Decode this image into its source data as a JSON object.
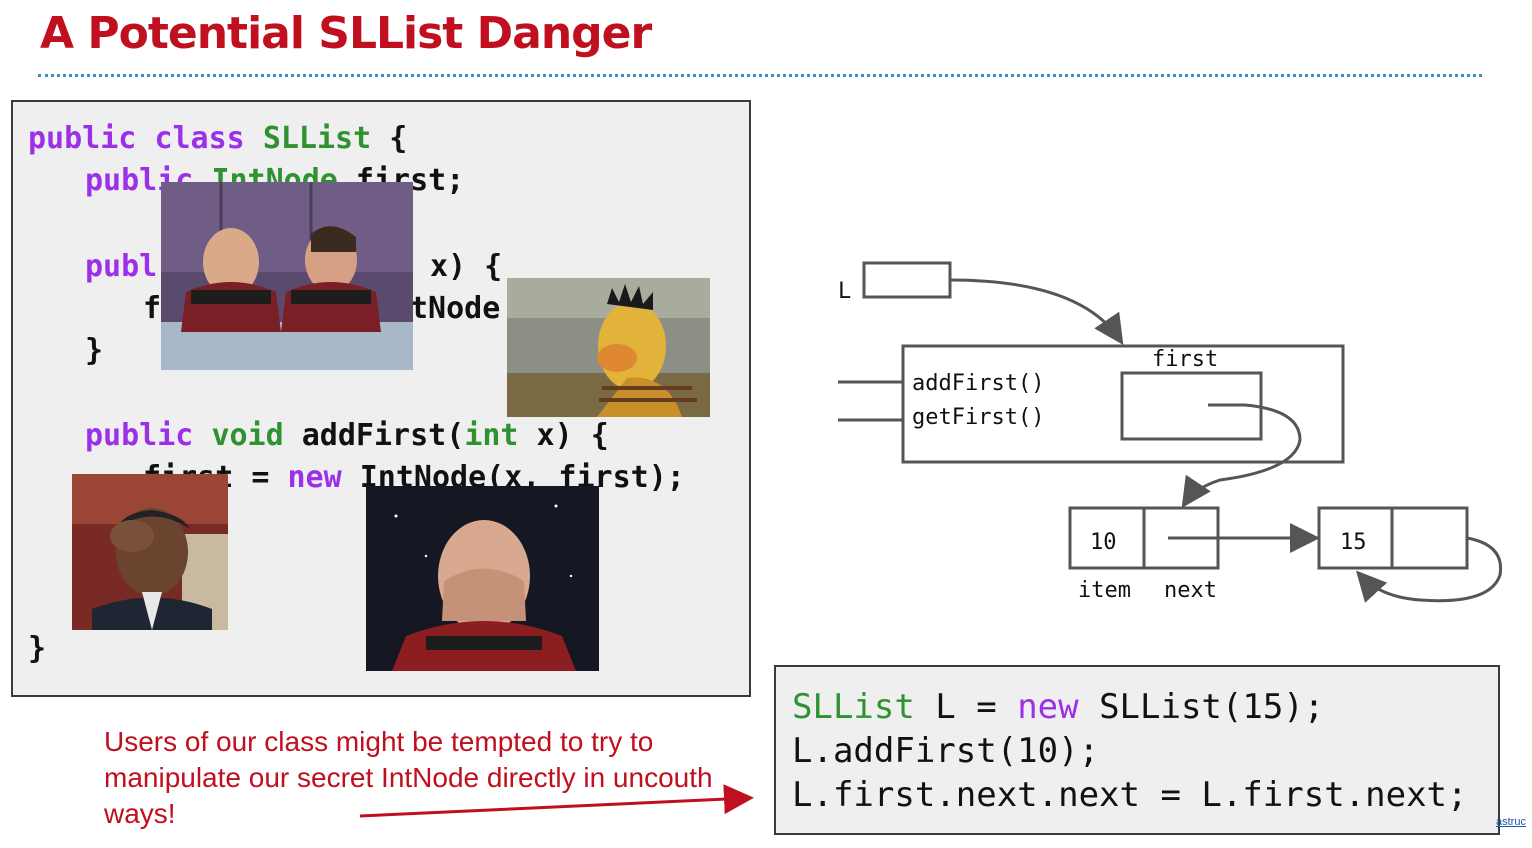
{
  "title": "A Potential SLList Danger",
  "code": {
    "line1": {
      "kw1": "public",
      "kw2": "class",
      "name": "SLList",
      "brace": " {"
    },
    "line2": {
      "kw": "public",
      "type": "IntNode",
      "rest": " first;"
    },
    "line3": {
      "kw": "publ",
      "rest": "x) {"
    },
    "line4": {
      "start": "f",
      "rest": "tNode"
    },
    "line5": "}",
    "line6": {
      "kw1": "public",
      "kw2": "void",
      "name": " addFirst(",
      "type": "int",
      "rest": " x) {"
    },
    "line7": {
      "start": "first = ",
      "kw": "new",
      "rest": " IntNode(x, first);"
    },
    "line8": "}"
  },
  "note": "Users of our class might be tempted to try to manipulate our secret IntNode directly in uncouth ways!",
  "client_code": {
    "line1": {
      "type": "SLList",
      "mid": " L = ",
      "kw": "new",
      "rest": " SLList(15);"
    },
    "line2": "L.addFirst(10);",
    "line3": "L.first.next.next = L.first.next;"
  },
  "diagram": {
    "var_label": "L",
    "field_label": "first",
    "method1": "addFirst()",
    "method2": "getFirst()",
    "node1_item": "10",
    "node2_item": "15",
    "item_label": "item",
    "next_label": "next"
  },
  "images": [
    "picard-riker-facepalm",
    "bert-facepalm",
    "obama-facepalm",
    "picard-facepalm"
  ],
  "corner_text": "astruc",
  "colors": {
    "title": "#c00f1e",
    "keyword": "#9c30e8",
    "type": "#2e9230",
    "note": "#c00f1e",
    "divider": "#3d8fc6"
  }
}
